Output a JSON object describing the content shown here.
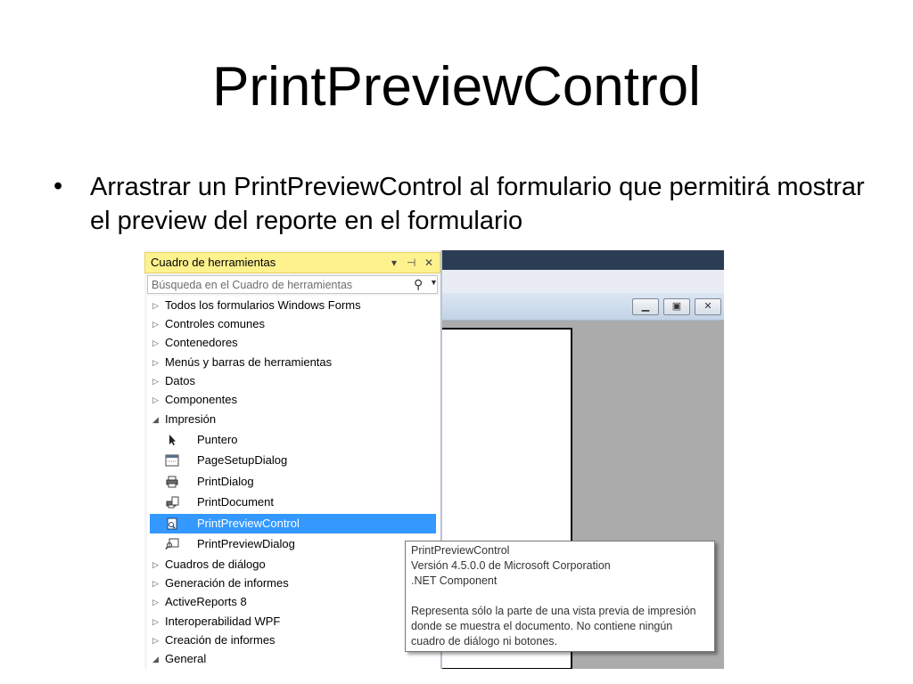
{
  "slide": {
    "title": "PrintPreviewControl",
    "bullet": "Arrastrar un PrintPreviewControl al formulario que permitirá mostrar el preview del reporte en el formulario"
  },
  "toolbox": {
    "title": "Cuadro de herramientas",
    "header_icons": [
      "dropdown-arrow-icon",
      "pin-icon",
      "close-icon"
    ],
    "search_placeholder": "Búsqueda en el Cuadro de herramientas",
    "categories_top": [
      {
        "label": "Todos los formularios Windows Forms",
        "expanded": false
      },
      {
        "label": "Controles comunes",
        "expanded": false
      },
      {
        "label": "Contenedores",
        "expanded": false
      },
      {
        "label": "Menús y barras de herramientas",
        "expanded": false
      },
      {
        "label": "Datos",
        "expanded": false
      },
      {
        "label": "Componentes",
        "expanded": false
      },
      {
        "label": "Impresión",
        "expanded": true
      }
    ],
    "impresion_items": [
      {
        "label": "Puntero",
        "icon": "pointer-icon",
        "selected": false
      },
      {
        "label": "PageSetupDialog",
        "icon": "page-setup-dialog-icon",
        "selected": false
      },
      {
        "label": "PrintDialog",
        "icon": "print-dialog-icon",
        "selected": false
      },
      {
        "label": "PrintDocument",
        "icon": "print-document-icon",
        "selected": false
      },
      {
        "label": "PrintPreviewControl",
        "icon": "print-preview-control-icon",
        "selected": true
      },
      {
        "label": "PrintPreviewDialog",
        "icon": "print-preview-dialog-icon",
        "selected": false
      }
    ],
    "categories_bottom": [
      {
        "label": "Cuadros de diálogo",
        "expanded": false
      },
      {
        "label": "Generación de informes",
        "expanded": false
      },
      {
        "label": "ActiveReports 8",
        "expanded": false
      },
      {
        "label": "Interoperabilidad WPF",
        "expanded": false
      },
      {
        "label": "Creación de informes",
        "expanded": false
      },
      {
        "label": "General",
        "expanded": true
      }
    ]
  },
  "tooltip": {
    "name": "PrintPreviewControl",
    "version": "Versión 4.5.0.0 de Microsoft Corporation",
    "kind": ".NET Component",
    "description_line1": "Representa sólo la parte de una vista previa de impresión",
    "description_line2": "donde se muestra el documento. No contiene ningún",
    "description_line3": "cuadro de diálogo ni botones."
  },
  "form_window": {
    "buttons": [
      "minimize-button",
      "maximize-button",
      "close-button"
    ]
  },
  "colors": {
    "toolbox_header": "#fef28f",
    "selection": "#3399ff",
    "designer_title": "#2b3c55",
    "preview_background": "#ababab"
  }
}
